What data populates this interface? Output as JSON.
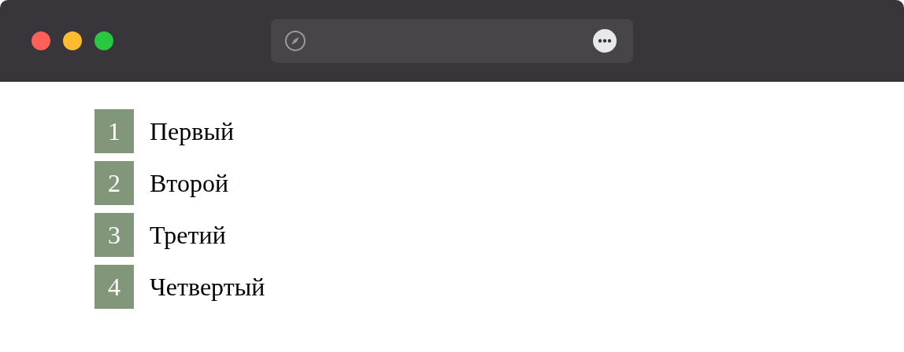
{
  "items": [
    {
      "number": "1",
      "label": "Первый"
    },
    {
      "number": "2",
      "label": "Второй"
    },
    {
      "number": "3",
      "label": "Третий"
    },
    {
      "number": "4",
      "label": "Четвертый"
    }
  ]
}
